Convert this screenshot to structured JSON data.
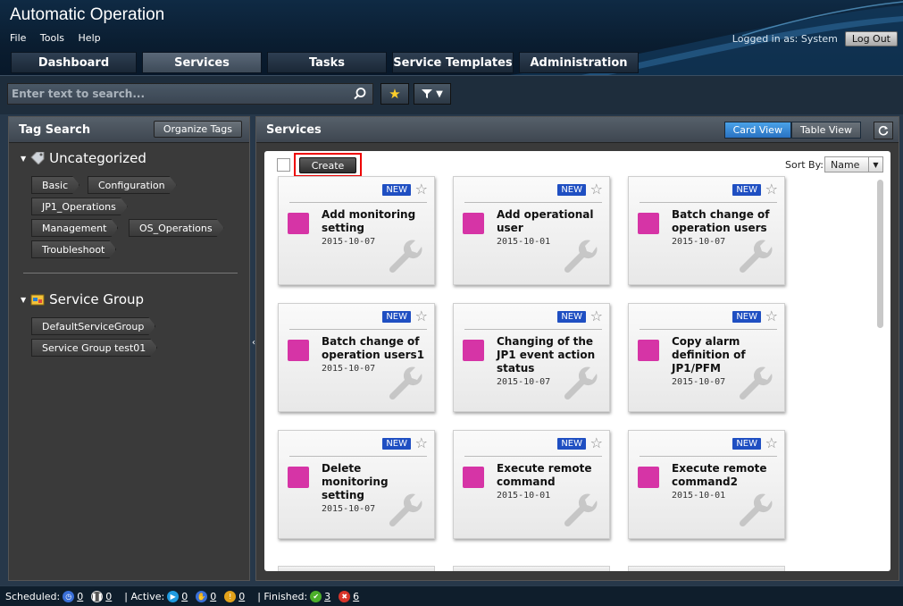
{
  "app": {
    "title": "Automatic Operation"
  },
  "menu": [
    "File",
    "Tools",
    "Help"
  ],
  "login": {
    "text": "Logged in as: System",
    "logout_label": "Log Out"
  },
  "tabs": [
    {
      "label": "Dashboard",
      "active": false
    },
    {
      "label": "Services",
      "active": true
    },
    {
      "label": "Tasks",
      "active": false
    },
    {
      "label": "Service Templates",
      "active": false
    },
    {
      "label": "Administration",
      "active": false
    }
  ],
  "search": {
    "placeholder": "Enter text to search...",
    "value": ""
  },
  "tag_search": {
    "title": "Tag Search",
    "organize_label": "Organize Tags",
    "uncategorized_label": "Uncategorized",
    "tags": [
      "Basic",
      "Configuration",
      "JP1_Operations",
      "Management",
      "OS_Operations",
      "Troubleshoot"
    ],
    "service_group_label": "Service Group",
    "service_groups": [
      "DefaultServiceGroup",
      "Service Group test01"
    ]
  },
  "services": {
    "title": "Services",
    "card_view_label": "Card View",
    "table_view_label": "Table View",
    "create_label": "Create",
    "sort_label": "Sort By:",
    "sort_value": "Name",
    "cards": [
      {
        "name": "Add monitoring setting",
        "date": "2015-10-07",
        "badge": "NEW"
      },
      {
        "name": "Add operational user",
        "date": "2015-10-01",
        "badge": "NEW"
      },
      {
        "name": "Batch change of operation users",
        "date": "2015-10-07",
        "badge": "NEW"
      },
      {
        "name": "Batch change of operation users1",
        "date": "2015-10-07",
        "badge": "NEW"
      },
      {
        "name": "Changing of the JP1 event action status",
        "date": "2015-10-07",
        "badge": "NEW"
      },
      {
        "name": "Copy alarm definition of JP1/PFM",
        "date": "2015-10-07",
        "badge": "NEW"
      },
      {
        "name": "Delete monitoring setting",
        "date": "2015-10-07",
        "badge": "NEW"
      },
      {
        "name": "Execute remote command",
        "date": "2015-10-01",
        "badge": "NEW"
      },
      {
        "name": "Execute remote command2",
        "date": "2015-10-01",
        "badge": "NEW"
      }
    ]
  },
  "statusbar": {
    "scheduled_label": "Scheduled:",
    "scheduled_count": "0",
    "paused_count": "0",
    "active_label": "| Active:",
    "active_count": "0",
    "waiting_count": "0",
    "warning_count": "0",
    "finished_label": "| Finished:",
    "completed_count": "3",
    "failed_count": "6",
    "colors": {
      "scheduled": "#3a6fd8",
      "active": "#1f9be0",
      "warning": "#e2a21a",
      "completed": "#4caf2a",
      "failed": "#d8342a"
    }
  }
}
